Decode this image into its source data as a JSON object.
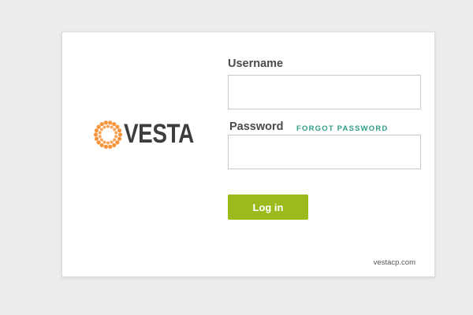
{
  "brand": {
    "name": "VESTA",
    "logo_icon": "sunburst-ring-icon",
    "accent_color": "#f7943c",
    "text_color": "#3d3d3d"
  },
  "form": {
    "username_label": "Username",
    "username_value": "",
    "password_label": "Password",
    "password_value": "",
    "forgot_password_label": "FORGOT PASSWORD",
    "login_button_label": "Log in",
    "button_color": "#9bbb1c",
    "link_color": "#2e9c88"
  },
  "footer": {
    "site_link": "vestacp.com"
  }
}
